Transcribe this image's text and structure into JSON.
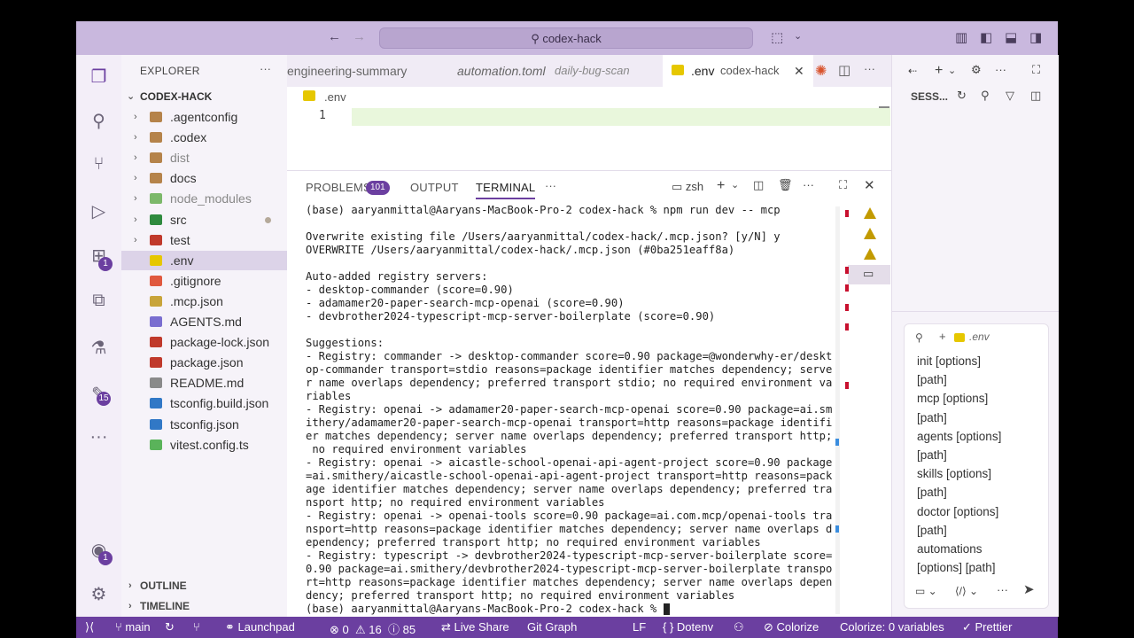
{
  "titlebar": {
    "search_text": "codex-hack"
  },
  "activity": {
    "extensions_badge": "1",
    "source_badge": "15",
    "account_badge": "1"
  },
  "sidebar": {
    "title": "EXPLORER",
    "root": "CODEX-HACK",
    "items": [
      {
        "label": ".agentconfig",
        "type": "folder"
      },
      {
        "label": ".codex",
        "type": "folder"
      },
      {
        "label": "dist",
        "type": "folder"
      },
      {
        "label": "docs",
        "type": "folder"
      },
      {
        "label": "node_modules",
        "type": "folder"
      },
      {
        "label": "src",
        "type": "folder"
      },
      {
        "label": "test",
        "type": "folder"
      },
      {
        "label": ".env",
        "type": "file"
      },
      {
        "label": ".gitignore",
        "type": "file"
      },
      {
        "label": ".mcp.json",
        "type": "file"
      },
      {
        "label": "AGENTS.md",
        "type": "file"
      },
      {
        "label": "package-lock.json",
        "type": "file"
      },
      {
        "label": "package.json",
        "type": "file"
      },
      {
        "label": "README.md",
        "type": "file"
      },
      {
        "label": "tsconfig.build.json",
        "type": "file"
      },
      {
        "label": "tsconfig.json",
        "type": "file"
      },
      {
        "label": "vitest.config.ts",
        "type": "file"
      }
    ],
    "outline": "OUTLINE",
    "timeline": "TIMELINE"
  },
  "tabs": [
    {
      "label": "engineering-summary",
      "detail": ""
    },
    {
      "label": "automation.toml",
      "detail": "daily-bug-scan"
    },
    {
      "label": ".env",
      "detail": "codex-hack"
    }
  ],
  "editor": {
    "breadcrumb": ".env",
    "line_number": "1"
  },
  "panel": {
    "tabs": [
      "PROBLEMS",
      "OUTPUT",
      "TERMINAL"
    ],
    "problems_count": "101",
    "shell": "zsh",
    "terminal_lines": [
      "(base) aaryanmittal@Aaryans-MacBook-Pro-2 codex-hack % npm run dev -- mcp",
      "",
      "Overwrite existing file /Users/aaryanmittal/codex-hack/.mcp.json? [y/N] y",
      "OVERWRITE /Users/aaryanmittal/codex-hack/.mcp.json (#0ba251eaff8a)",
      "",
      "Auto-added registry servers:",
      "- desktop-commander (score=0.90)",
      "- adamamer20-paper-search-mcp-openai (score=0.90)",
      "- devbrother2024-typescript-mcp-server-boilerplate (score=0.90)",
      "",
      "Suggestions:",
      "- Registry: commander -> desktop-commander score=0.90 package=@wonderwhy-er/deskt",
      "op-commander transport=stdio reasons=package identifier matches dependency; serve",
      "r name overlaps dependency; preferred transport stdio; no required environment va",
      "riables",
      "- Registry: openai -> adamamer20-paper-search-mcp-openai score=0.90 package=ai.sm",
      "ithery/adamamer20-paper-search-mcp-openai transport=http reasons=package identifi",
      "er matches dependency; server name overlaps dependency; preferred transport http;",
      " no required environment variables",
      "- Registry: openai -> aicastle-school-openai-api-agent-project score=0.90 package",
      "=ai.smithery/aicastle-school-openai-api-agent-project transport=http reasons=pack",
      "age identifier matches dependency; server name overlaps dependency; preferred tra",
      "nsport http; no required environment variables",
      "- Registry: openai -> openai-tools score=0.90 package=ai.com.mcp/openai-tools tra",
      "nsport=http reasons=package identifier matches dependency; server name overlaps d",
      "ependency; preferred transport http; no required environment variables",
      "- Registry: typescript -> devbrother2024-typescript-mcp-server-boilerplate score=",
      "0.90 package=ai.smithery/devbrother2024-typescript-mcp-server-boilerplate transpo",
      "rt=http reasons=package identifier matches dependency; server name overlaps depen",
      "dency; preferred transport http; no required environment variables",
      "(base) aaryanmittal@Aaryans-MacBook-Pro-2 codex-hack % "
    ]
  },
  "rightpane": {
    "title": "SESS...",
    "context_file": ".env",
    "suggestions": [
      "init [options]",
      "[path]",
      "mcp [options]",
      "[path]",
      "agents [options]",
      "[path]",
      "skills [options]",
      "[path]",
      "doctor [options]",
      "[path]",
      "automations",
      "[options] [path]"
    ]
  },
  "statusbar": {
    "branch": "main",
    "launchpad": "Launchpad",
    "errors": "0",
    "warnings": "16",
    "info": "85",
    "liveshare": "Live Share",
    "gitgraph": "Git Graph",
    "eol": "LF",
    "lang": "Dotenv",
    "colorize": "Colorize",
    "colorize_vars": "Colorize: 0 variables",
    "prettier": "Prettier"
  },
  "colors": {
    "accent": "#6b3fa0",
    "titlebar": "#c9b8de",
    "warning": "#c29a00",
    "error_marker": "#c8102e"
  }
}
